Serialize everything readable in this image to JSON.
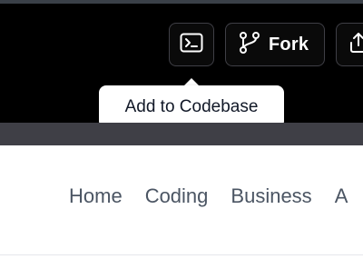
{
  "toolbar": {
    "codebase_icon": "terminal-icon",
    "fork_icon": "git-fork-icon",
    "fork_label": "Fork",
    "share_icon": "share-upload-icon"
  },
  "tooltip": {
    "text": "Add to Codebase"
  },
  "nav": {
    "items": [
      {
        "label": "Home"
      },
      {
        "label": "Coding"
      },
      {
        "label": "Business"
      },
      {
        "label": "A"
      }
    ]
  },
  "colors": {
    "topbar_bg": "#000000",
    "button_border": "#3f3f46",
    "strip_bg": "#3f3f46",
    "tooltip_bg": "#ffffff",
    "nav_text": "#4b5563"
  }
}
